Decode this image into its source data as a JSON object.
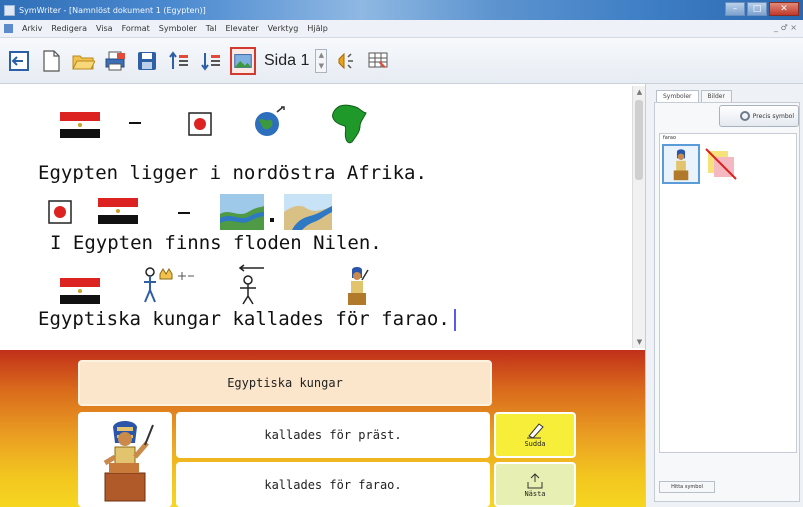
{
  "window": {
    "title": "SymWriter - [Namnlöst dokument 1 (Egypten)]",
    "controls": [
      "–",
      "□",
      "✕"
    ]
  },
  "menu": {
    "items": [
      "Arkiv",
      "Redigera",
      "Visa",
      "Format",
      "Symboler",
      "Tal",
      "Elevater",
      "Verktyg",
      "Hjälp"
    ],
    "right": "_ ♂ ×"
  },
  "toolbar": {
    "page_label": "Sida 1",
    "icons": [
      "exit-icon",
      "new-document-icon",
      "open-folder-icon",
      "print-icon",
      "save-icon",
      "increase-spacing-icon",
      "decrease-spacing-icon",
      "picture-icon",
      "speaker-icon",
      "grid-icon"
    ]
  },
  "document": {
    "lines": [
      {
        "text": "Egypten ligger i nordöstra Afrika."
      },
      {
        "text": "I Egypten finns floden Nilen."
      },
      {
        "text": "Egyptiska kungar kallades för farao."
      }
    ]
  },
  "grid": {
    "header": "Egyptiska kungar",
    "rows": [
      {
        "text": "kallades för präst.",
        "action_label": "Sudda"
      },
      {
        "text": "kallades för farao.",
        "action_label": "Nästa"
      }
    ],
    "colors": {
      "top": "#c1301a",
      "bottom": "#f6d620",
      "action_yellow": "#f7ee3a",
      "action_green": "#e8efb2"
    }
  },
  "side_panel": {
    "tabs": [
      "Symboler",
      "Bilder"
    ],
    "find_button": "Precis symbol",
    "results_label": "farao",
    "bottom_tab": "Hitta symbol"
  }
}
